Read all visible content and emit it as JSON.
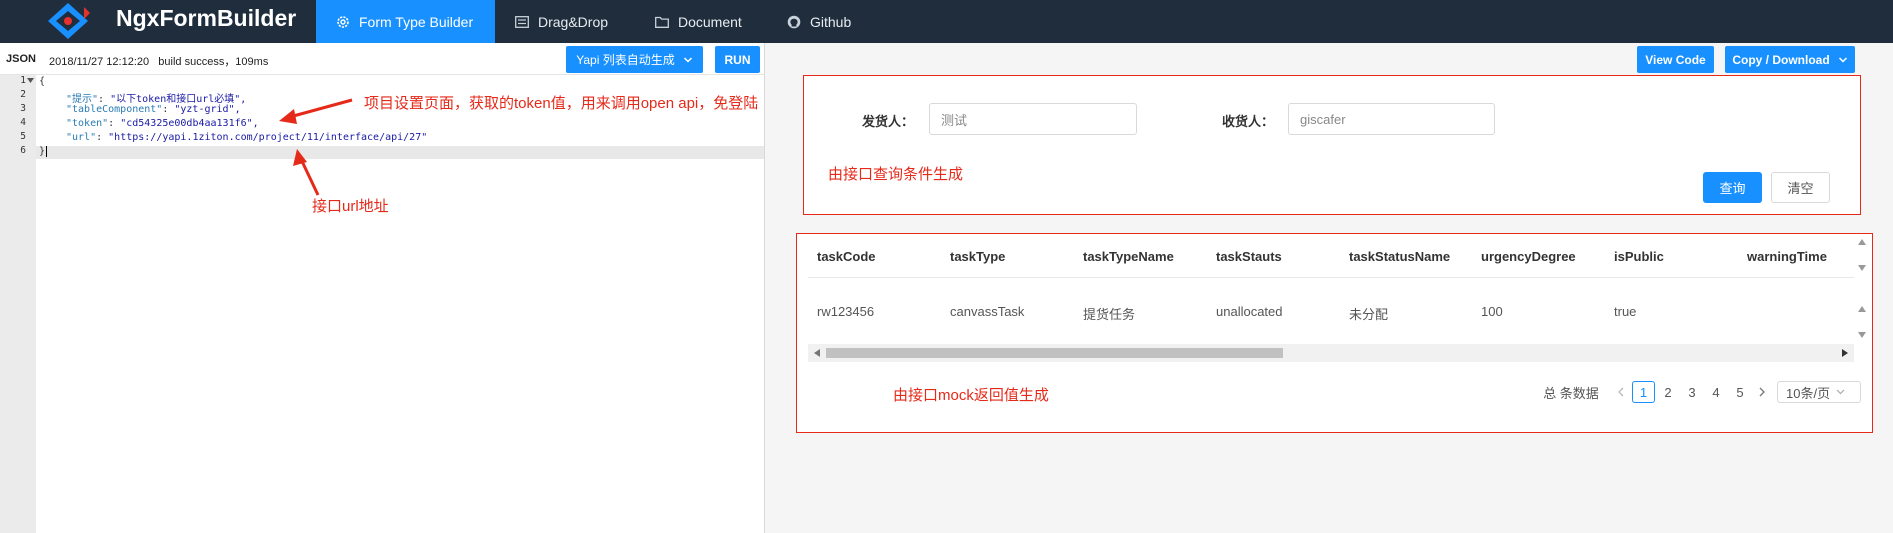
{
  "header": {
    "brand": "NgxFormBuilder",
    "tabs": [
      {
        "label": "Form Type Builder",
        "icon": "gear-icon",
        "active": true
      },
      {
        "label": "Drag&Drop",
        "icon": "form-icon"
      },
      {
        "label": "Document",
        "icon": "folder-icon"
      },
      {
        "label": "Github",
        "icon": "github-icon"
      }
    ]
  },
  "editor": {
    "mode_label": "JSON",
    "status": "2018/11/27 12:12:20   build success，109ms",
    "generate_button": "Yapi 列表自动生成",
    "run_button": "RUN",
    "line_numbers": [
      "1",
      "2",
      "3",
      "4",
      "5",
      "6"
    ],
    "lines": [
      {
        "key": "\"提示\"",
        "value": "\"以下token和接口url必填\","
      },
      {
        "key": "\"tableComponent\"",
        "value": "\"yzt-grid\","
      },
      {
        "key": "\"token\"",
        "value": "\"cd54325e00db4aa131f6\","
      },
      {
        "key": "\"url\"",
        "value": "\"https://yapi.1ziton.com/project/11/interface/api/27\""
      }
    ],
    "open_brace": "{",
    "close_brace": "}",
    "annotations": {
      "token_note": "项目设置页面，获取的token值，用来调用open api，免登陆",
      "url_note": "接口url地址"
    }
  },
  "preview": {
    "view_code_button": "View Code",
    "copy_download_button": "Copy / Download",
    "form": {
      "sender_label": "发货人：",
      "sender_value": "测试",
      "receiver_label": "收货人：",
      "receiver_value": "giscafer",
      "note": "由接口查询条件生成",
      "query_button": "查询",
      "clear_button": "清空"
    },
    "table": {
      "columns": [
        "taskCode",
        "taskType",
        "taskTypeName",
        "taskStauts",
        "taskStatusName",
        "urgencyDegree",
        "isPublic",
        "warningTime"
      ],
      "rows": [
        [
          "rw123456",
          "canvassTask",
          "提货任务",
          "unallocated",
          "未分配",
          "100",
          "true",
          ""
        ]
      ],
      "note": "由接口mock返回值生成"
    },
    "pagination": {
      "total_text": "总 条数据",
      "pages": [
        "1",
        "2",
        "3",
        "4",
        "5"
      ],
      "current_page": "1",
      "page_size": "10条/页"
    }
  }
}
